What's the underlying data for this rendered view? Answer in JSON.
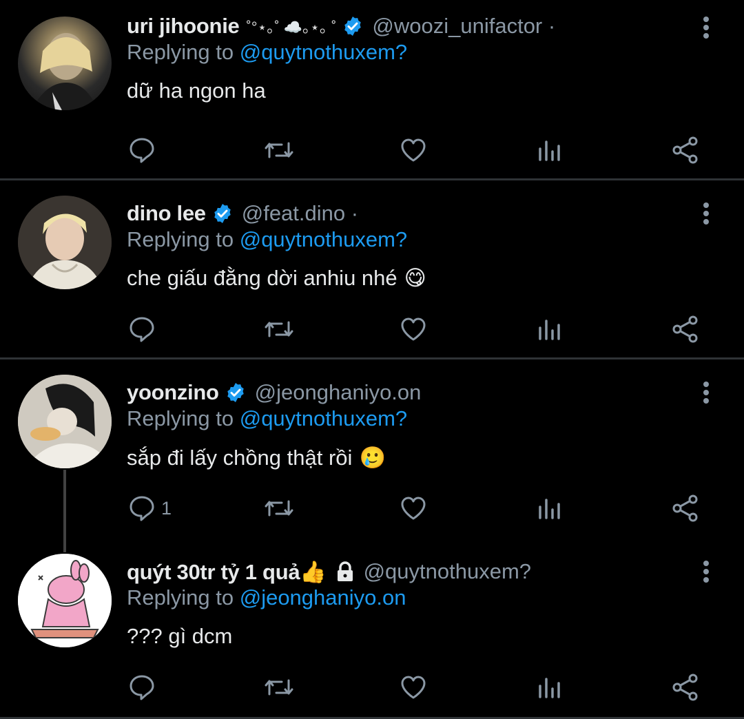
{
  "tweets": [
    {
      "name": "uri jihoonie",
      "decoration": "˚°⋆｡˚ ☁️｡⋆｡ ˚",
      "verified": true,
      "handle": "@woozi_unifactor ·",
      "replying_prefix": "Replying to",
      "replying_to": "@quytnothuxem?",
      "text": "dữ ha ngon ha",
      "emoji": "",
      "reply_count": ""
    },
    {
      "name": "dino lee",
      "decoration": "",
      "verified": true,
      "handle": "@feat.dino ·",
      "replying_prefix": "Replying to",
      "replying_to": "@quytnothuxem?",
      "text": "che giấu đằng dời anhiu nhé",
      "emoji": "😋",
      "reply_count": ""
    },
    {
      "name": "yoonzino",
      "decoration": "",
      "verified": true,
      "handle": "@jeonghaniyo.on",
      "replying_prefix": "Replying to",
      "replying_to": "@quytnothuxem?",
      "text": "sắp đi lấy chồng thật rồi",
      "emoji": "🥲",
      "reply_count": "1"
    },
    {
      "name": "quýt 30tr tỷ 1 quả👍",
      "decoration": "",
      "verified": false,
      "locked": true,
      "handle": "@quytnothuxem?",
      "replying_prefix": "Replying to",
      "replying_to": "@jeonghaniyo.on",
      "text": "??? gì dcm",
      "emoji": "",
      "reply_count": ""
    }
  ],
  "icons": {
    "reply": "reply-icon",
    "retweet": "retweet-icon",
    "like": "heart-icon",
    "analytics": "analytics-icon",
    "share": "share-icon",
    "more": "more-vertical-icon",
    "verified": "verified-badge-icon",
    "lock": "lock-icon"
  },
  "colors": {
    "background": "#000000",
    "accent": "#1d9bf0",
    "muted": "#8b98a5",
    "text": "#e7e9ea",
    "divider": "#2f3336"
  }
}
